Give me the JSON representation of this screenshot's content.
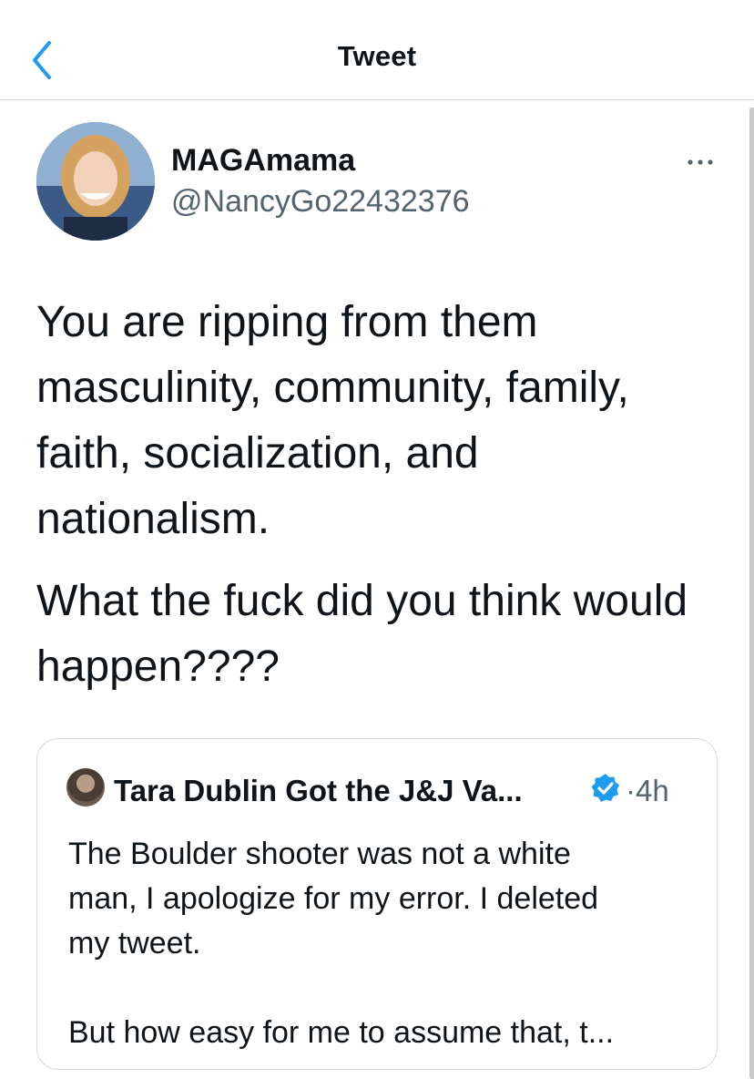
{
  "header": {
    "title": "Tweet",
    "back_icon": "chevron-left-icon",
    "accent_color": "#1d9bf0"
  },
  "tweet": {
    "author": {
      "display_name": "MAGAmama",
      "handle": "@NancyGo22432376"
    },
    "more_icon": "ellipsis-icon",
    "text": {
      "paragraph_1_lines": [
        "You are ripping from them",
        "masculinity, community, family,",
        "faith, socialization, and",
        "nationalism."
      ],
      "paragraph_2_lines": [
        "What the fuck did you think would",
        "happen????"
      ]
    },
    "quoted": {
      "author_name": "Tara Dublin Got the J&J Va...",
      "verified_icon": "verified-badge-icon",
      "separator": "·",
      "time": "4h",
      "paragraph_1_lines": [
        "The Boulder shooter was not a white",
        "man, I apologize for my error. I deleted",
        "my tweet."
      ],
      "paragraph_2_lines": [
        "But how easy for me to assume that, t..."
      ]
    }
  }
}
